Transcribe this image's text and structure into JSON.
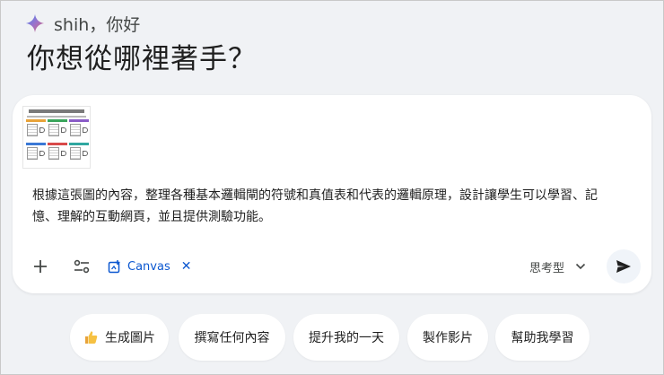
{
  "greeting": {
    "text": "shih，你好",
    "icon": "gemini-sparkle-icon"
  },
  "headline": "你想從哪裡著手？",
  "composer": {
    "attachment": {
      "icon": "image-thumbnail"
    },
    "prompt_text": "根據這張圖的內容，整理各種基本邏輯閘的符號和真值表和代表的邏輯原理，設計讓學生可以學習、記憶、理解的互動網頁，並且提供測驗功能。",
    "toolbar": {
      "add_icon": "plus-icon",
      "tools_icon": "tune-icon",
      "canvas_label": "Canvas",
      "canvas_icon": "canvas-icon",
      "canvas_remove_icon": "close-icon",
      "model_label": "思考型",
      "model_icon": "chevron-down-icon",
      "send_icon": "send-icon"
    }
  },
  "suggestions": [
    {
      "label": "生成圖片",
      "icon": "thumbs-up-emoji"
    },
    {
      "label": "撰寫任何內容"
    },
    {
      "label": "提升我的一天"
    },
    {
      "label": "製作影片"
    },
    {
      "label": "幫助我學習"
    }
  ],
  "colors": {
    "background": "#f0f2f5",
    "card": "#ffffff",
    "accent": "#0b57d0",
    "text": "#1f1f1f",
    "muted": "#444746"
  }
}
